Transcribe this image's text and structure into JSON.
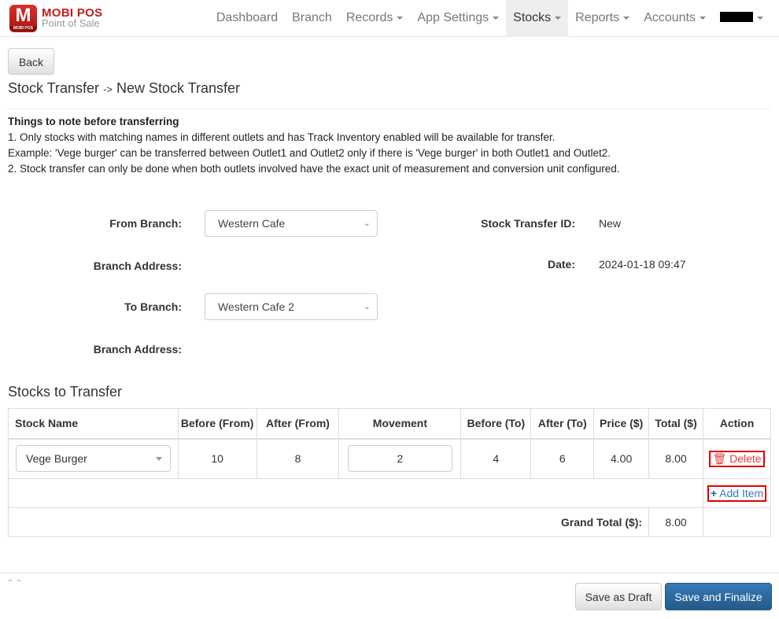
{
  "brand": {
    "logo_letter": "M",
    "logo_sub": "MOBI POS",
    "title": "MOBI POS",
    "subtitle": "Point of Sale"
  },
  "nav": {
    "items": [
      {
        "label": "Dashboard",
        "dropdown": false
      },
      {
        "label": "Branch",
        "dropdown": false
      },
      {
        "label": "Records",
        "dropdown": true
      },
      {
        "label": "App Settings",
        "dropdown": true
      },
      {
        "label": "Stocks",
        "dropdown": true,
        "active": true
      },
      {
        "label": "Reports",
        "dropdown": true
      },
      {
        "label": "Accounts",
        "dropdown": true
      }
    ],
    "user_menu": {
      "label": "",
      "redacted": true
    }
  },
  "back_label": "Back",
  "title": {
    "parent": "Stock Transfer",
    "separator": "->",
    "current": "New Stock Transfer"
  },
  "notes": {
    "heading": "Things to note before transferring",
    "lines": [
      "1. Only stocks with matching names in different outlets and has Track Inventory enabled will be available for transfer.",
      "Example: 'Vege burger' can be transferred between Outlet1 and Outlet2 only if there is 'Vege burger' in both Outlet1 and Outlet2.",
      "2. Stock transfer can only be done when both outlets involved have the exact unit of measurement and conversion unit configured."
    ]
  },
  "form": {
    "from_branch_label": "From Branch:",
    "from_branch_value": "Western Cafe",
    "from_address_label": "Branch Address:",
    "from_address_value": "",
    "to_branch_label": "To Branch:",
    "to_branch_value": "Western Cafe 2",
    "to_address_label": "Branch Address:",
    "to_address_value": "",
    "transfer_id_label": "Stock Transfer ID:",
    "transfer_id_value": "New",
    "date_label": "Date:",
    "date_value": "2024-01-18 09:47"
  },
  "stocks": {
    "section_title": "Stocks to Transfer",
    "columns": [
      "Stock Name",
      "Before (From)",
      "After (From)",
      "Movement",
      "Before (To)",
      "After (To)",
      "Price ($)",
      "Total ($)",
      "Action"
    ],
    "rows": [
      {
        "stock_name": "Vege Burger",
        "before_from": "10",
        "after_from": "8",
        "movement": "2",
        "before_to": "4",
        "after_to": "6",
        "price": "4.00",
        "total": "8.00",
        "action": "Delete"
      }
    ],
    "add_item_label": "Add Item",
    "grand_total_label": "Grand Total ($):",
    "grand_total_value": "8.00"
  },
  "footer": {
    "draft_label": "Save as Draft",
    "finalize_label": "Save and Finalize"
  },
  "colors": {
    "brand_red": "#c61b18",
    "primary": "#337ab7",
    "delete": "#e04040",
    "highlight_border": "#e00000"
  }
}
